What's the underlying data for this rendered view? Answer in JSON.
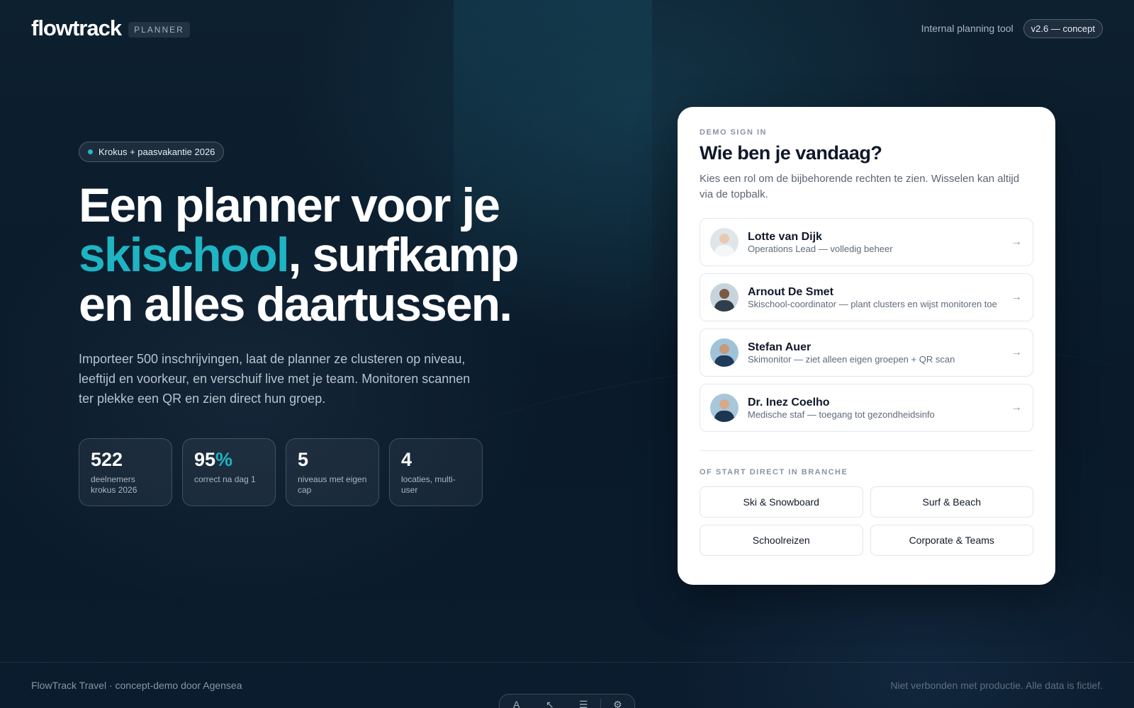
{
  "header": {
    "logo": "flowtrack",
    "logo_badge": "PLANNER",
    "tagline": "Internal planning tool",
    "version": "v2.6 — concept"
  },
  "hero": {
    "tag": "Krokus + paasvakantie 2026",
    "headline_part1": "Een planner voor je ",
    "headline_accent": "skischool",
    "headline_part2": ", surfkamp en alles daartussen.",
    "lede": "Importeer 500 inschrijvingen, laat de planner ze clusteren op niveau, leeftijd en voorkeur, en verschuif live met je team. Monitoren scannen ter plekke een QR en zien direct hun groep.",
    "stats": [
      {
        "value": "522",
        "suffix": "",
        "label": "deelnemers krokus 2026"
      },
      {
        "value": "95",
        "suffix": "%",
        "label": "correct na dag 1"
      },
      {
        "value": "5",
        "suffix": "",
        "label": "niveaus met eigen cap"
      },
      {
        "value": "4",
        "suffix": "",
        "label": "locaties, multi-user"
      }
    ]
  },
  "signin": {
    "eyebrow": "DEMO SIGN IN",
    "title": "Wie ben je vandaag?",
    "description": "Kies een rol om de bijbehorende rechten te zien. Wisselen kan altijd via de topbalk.",
    "roles": [
      {
        "name": "Lotte van Dijk",
        "desc": "Operations Lead — volledig beheer",
        "icon": "arrow-right-icon"
      },
      {
        "name": "Arnout De Smet",
        "desc": "Skischool-coordinator — plant clusters en wijst monitoren toe",
        "icon": "arrow-right-icon"
      },
      {
        "name": "Stefan Auer",
        "desc": "Skimonitor — ziet alleen eigen groepen + QR scan",
        "icon": "arrow-right-icon"
      },
      {
        "name": "Dr. Inez Coelho",
        "desc": "Medische staf — toegang tot gezondheidsinfo",
        "icon": "arrow-right-icon"
      }
    ],
    "branch_eyebrow": "OF START DIRECT IN BRANCHE",
    "branches": [
      "Ski & Snowboard",
      "Surf & Beach",
      "Schoolreizen",
      "Corporate & Teams"
    ]
  },
  "footer": {
    "left": "FlowTrack Travel · concept-demo door Agensea",
    "right": "Niet verbonden met productie. Alle data is fictief."
  },
  "colors": {
    "accent": "#1fb4c4",
    "background": "#0b1a2b",
    "card": "#ffffff"
  }
}
